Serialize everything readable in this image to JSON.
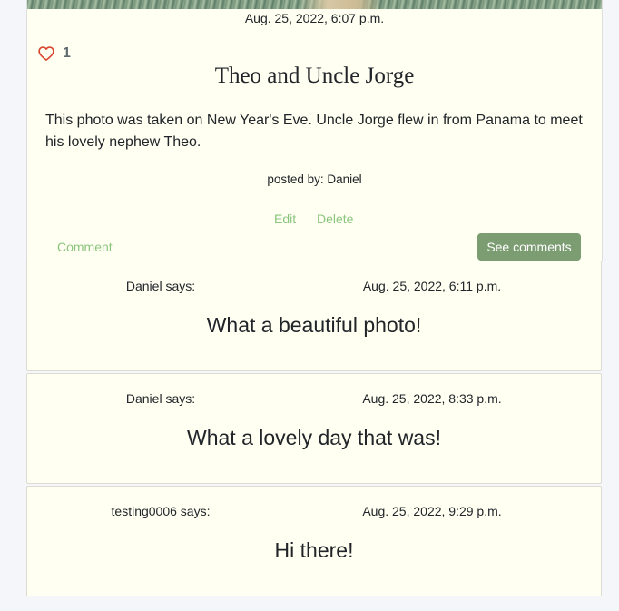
{
  "post": {
    "date": "Aug. 25, 2022, 6:07 p.m.",
    "likes": "1",
    "title": "Theo and Uncle Jorge",
    "body": "This photo was taken on New Year's Eve. Uncle Jorge flew in from Panama to meet his lovely nephew Theo.",
    "posted_by": "posted by: Daniel",
    "edit_label": "Edit",
    "delete_label": "Delete",
    "comment_label": "Comment",
    "see_comments_label": "See comments",
    "like_icon": "heart-outline-icon",
    "accent_color": "#8bc57d",
    "button_color": "#7c9c72",
    "heart_color": "#d9452f"
  },
  "comments": [
    {
      "author": "Daniel says:",
      "date": "Aug. 25, 2022, 6:11 p.m.",
      "text": "What a beautiful photo!"
    },
    {
      "author": "Daniel says:",
      "date": "Aug. 25, 2022, 8:33 p.m.",
      "text": "What a lovely day that was!"
    },
    {
      "author": "testing0006 says:",
      "date": "Aug. 25, 2022, 9:29 p.m.",
      "text": "Hi there!"
    }
  ]
}
